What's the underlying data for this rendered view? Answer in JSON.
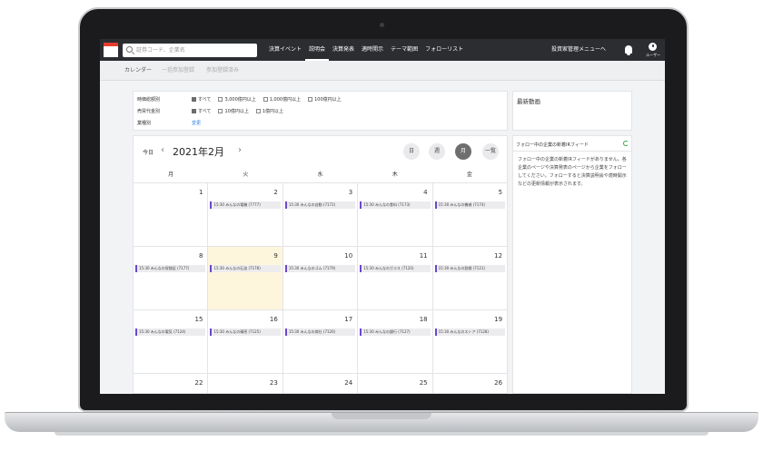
{
  "topbar": {
    "search_placeholder": "証券コード、企業名",
    "nav": [
      "決算イベント",
      "説明会",
      "決算発表",
      "適時開示",
      "テーマ範囲",
      "フォローリスト"
    ],
    "nav_active_index": 1,
    "mgmt_menu": "投資家管理メニューへ",
    "user_label": "ユーザー"
  },
  "subtabs": {
    "calendar": "カレンダー",
    "registered": "一括参加登録",
    "participation": "参加登録済み"
  },
  "filters": {
    "market_cap": {
      "label": "時価総額別",
      "options": [
        {
          "label": "すべて",
          "checked": true
        },
        {
          "label": "3,000億円以上",
          "checked": false
        },
        {
          "label": "1,000億円以上",
          "checked": false
        },
        {
          "label": "100億円以上",
          "checked": false
        }
      ]
    },
    "capital": {
      "label": "売買代金別",
      "options": [
        {
          "label": "すべて",
          "checked": true
        },
        {
          "label": "10億円以上",
          "checked": false
        },
        {
          "label": "1億円以上",
          "checked": false
        }
      ]
    },
    "industry": {
      "label": "業種別",
      "change": "変更"
    }
  },
  "videos": {
    "title": "最新動画"
  },
  "calendar": {
    "today": "今日",
    "month": "2021年2月",
    "views": [
      "日",
      "週",
      "月",
      "一覧"
    ],
    "active_view_index": 2,
    "weekdays": [
      "月",
      "火",
      "水",
      "木",
      "金"
    ],
    "weeks": [
      [
        {
          "day": "1",
          "event": "",
          "today": false
        },
        {
          "day": "2",
          "event": "15:30 みんなの電機 (7777)",
          "today": false
        },
        {
          "day": "3",
          "event": "15:30 みんなの自動 (7172)",
          "today": false
        },
        {
          "day": "4",
          "event": "15:30 みんなの食料 (7173)",
          "today": false
        },
        {
          "day": "5",
          "event": "15:30 みんなの機械 (7174)",
          "today": false
        }
      ],
      [
        {
          "day": "8",
          "event": "15:30 みんなの保険証 (7177)",
          "today": false
        },
        {
          "day": "9",
          "event": "15:30 みんなの石油 (7178)",
          "today": true
        },
        {
          "day": "10",
          "event": "15:30 みんなのゴム (7179)",
          "today": false
        },
        {
          "day": "11",
          "event": "15:30 みんなのガラス (7120)",
          "today": false
        },
        {
          "day": "12",
          "event": "15:30 みんなの鉄鋼 (7121)",
          "today": false
        }
      ],
      [
        {
          "day": "15",
          "event": "15:30 みんなの電気 (7124)",
          "today": false
        },
        {
          "day": "16",
          "event": "15:30 みんなの精密 (7125)",
          "today": false
        },
        {
          "day": "17",
          "event": "15:30 みんなの商社 (7126)",
          "today": false
        },
        {
          "day": "18",
          "event": "15:30 みんなの銀行 (7127)",
          "today": false
        },
        {
          "day": "19",
          "event": "15:30 みんなのストア (7128)",
          "today": false
        }
      ],
      [
        {
          "day": "22",
          "event": "",
          "today": false
        },
        {
          "day": "23",
          "event": "",
          "today": false
        },
        {
          "day": "24",
          "event": "",
          "today": false
        },
        {
          "day": "25",
          "event": "",
          "today": false
        },
        {
          "day": "26",
          "event": "",
          "today": false
        }
      ]
    ]
  },
  "feed": {
    "title": "フォロー中の企業の新着IRフィード",
    "body": "フォロー中の企業の新着IRフィードがありません。各企業のページや決算発表のページから企業をフォローしてください。フォローすると決算説明会や適時開示などの更新情報が表示されます。"
  },
  "colors": {
    "event_accent": "#6a47d0",
    "today_bg": "#fdf6dc",
    "topbar": "#2b2d31"
  }
}
